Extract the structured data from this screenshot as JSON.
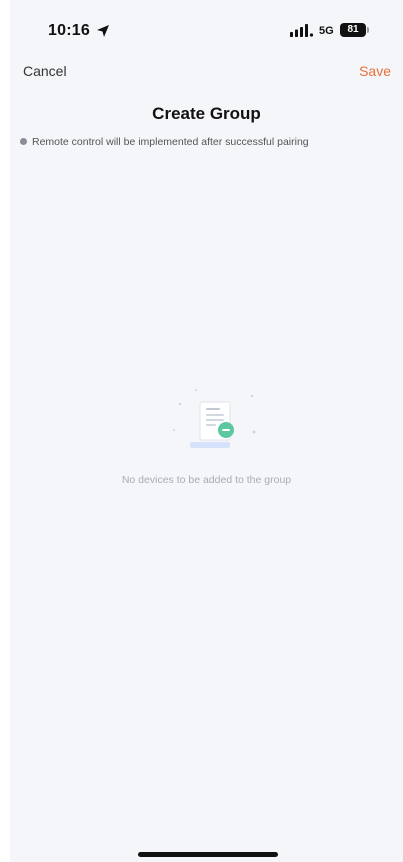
{
  "status_bar": {
    "time": "10:16",
    "network": "5G",
    "battery": "81",
    "icons": [
      "location-arrow-icon",
      "signal-icon",
      "battery-icon"
    ]
  },
  "nav": {
    "cancel_label": "Cancel",
    "save_label": "Save",
    "title": "Create Group"
  },
  "notice": {
    "icon": "info-dot-icon",
    "text": "Remote control will be implemented after successful pairing"
  },
  "empty_state": {
    "icon": "empty-document-illustration",
    "text": "No devices to be added to the group"
  },
  "colors": {
    "accent": "#e8713a",
    "background": "#f5f6fa",
    "illustration_green": "#5cc7a0",
    "illustration_blue": "#d6e2fb"
  }
}
